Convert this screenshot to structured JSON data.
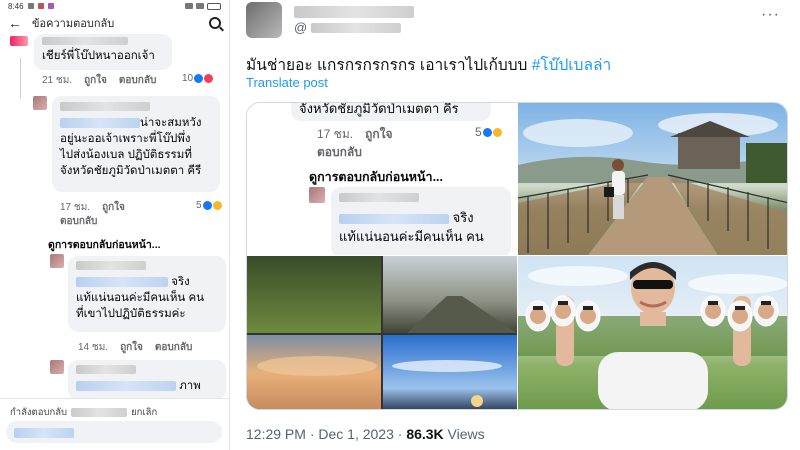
{
  "phone": {
    "status_time": "8:46",
    "header_title": "ข้อความตอบกลับ",
    "comments": [
      {
        "text": "เชียร์พี่โบ๊ปหนาออกเจ้า",
        "time": "21 ชม.",
        "like_label": "ถูกใจ",
        "reply_label": "ตอบกลับ",
        "reaction_count": "10"
      },
      {
        "text_suffix": "น่าจะสมหวัง",
        "text_lines": [
          "อยู่นะออเจ้าเพราะพี่โบ๊ปพึ่ง",
          "ไปส่งน้องเบล ปฏิบัติธรรมที่",
          "จังหวัดชัยภูมิวัดป่าเมตตา คีรี"
        ],
        "time": "17 ชม.",
        "like_label": "ถูกใจ",
        "reply_label": "ตอบกลับ",
        "reaction_count": "5"
      },
      {
        "text_suffix": "จริง",
        "text_lines": [
          "แท้แน่นอนค่ะมีคนเห็น คน",
          "ที่เขาไปปฏิบัติธรรมค่ะ"
        ],
        "time": "14 ชม.",
        "like_label": "ถูกใจ",
        "reply_label": "ตอบกลับ"
      },
      {
        "text_suffix": "ภาพ"
      }
    ],
    "see_previous": "ดูการตอบกลับก่อนหน้า...",
    "replying_to": "กำลังตอบกลับ",
    "cancel_label": "ยกเลิก"
  },
  "tweet": {
    "handle": "@",
    "text_main": "มันช่ายอะ แกรกรกรกรกร เอาเราไปเก้บบบ ",
    "hashtag": "#โบ๊ปเบลล่า",
    "translate": "Translate post",
    "more": "···",
    "crop_comments": {
      "top_text": "จังหวัดชัยภูมิวัดป่าเมตตา คีร",
      "time": "17 ชม.",
      "like_label": "ถูกใจ",
      "reply_label": "ตอบกลับ",
      "reaction_count": "5",
      "see_previous": "ดูการตอบกลับก่อนหน้า...",
      "reply_suffix": "จริง",
      "reply_line2": "แท้แน่นอนค่ะมีคนเห็น คน"
    },
    "timestamp": "12:29 PM · Dec 1, 2023 · ",
    "views_count": "86.3K",
    "views_label": " Views"
  },
  "colors": {
    "twitter_blue": "#1d9bf0",
    "fb_blue": "#1877f2",
    "bubble_gray": "#f0f2f5",
    "meta_gray": "#65676b"
  },
  "icons": [
    "back-arrow-icon",
    "search-icon",
    "like-reaction-icon",
    "wow-reaction-icon",
    "more-options-icon"
  ]
}
